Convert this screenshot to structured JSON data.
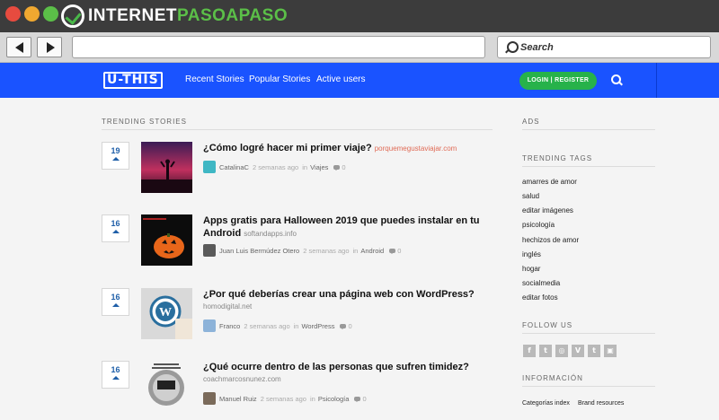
{
  "window": {
    "brand_prefix": "INTERNET",
    "brand_accent": "PASOAPASO",
    "search_placeholder": "Search"
  },
  "site": {
    "logo": "U-THIS",
    "nav": [
      "Recent Stories",
      "Popular Stories",
      "Active users"
    ],
    "login_label": "LOGIN | REGISTER",
    "brand_color": "#1a53ff",
    "login_color": "#27b24a"
  },
  "main": {
    "section_title": "TRENDING STORIES",
    "stories": [
      {
        "votes": "19",
        "title": "¿Cómo logré hacer mi primer viaje?",
        "domain": "porquemegustaviajar.com",
        "author": "CatalinaC",
        "time": "2 semanas ago",
        "in": "in",
        "category": "Viajes",
        "comments": "0"
      },
      {
        "votes": "16",
        "title": "Apps gratis para Halloween 2019 que puedes instalar en tu Android",
        "domain": "softandapps.info",
        "author": "Juan Luis Bermúdez Otero",
        "time": "2 semanas ago",
        "in": "in",
        "category": "Android",
        "comments": "0"
      },
      {
        "votes": "16",
        "title": "¿Por qué deberías crear una página web con WordPress?",
        "domain": "homodigital.net",
        "author": "Franco",
        "time": "2 semanas ago",
        "in": "in",
        "category": "WordPress",
        "comments": "0"
      },
      {
        "votes": "16",
        "title": "¿Qué ocurre dentro de las personas que sufren timidez?",
        "domain": "coachmarcosnunez.com",
        "author": "Manuel Ruiz",
        "time": "2 semanas ago",
        "in": "in",
        "category": "Psicología",
        "comments": "0"
      }
    ]
  },
  "sidebar": {
    "ads_title": "ADS",
    "tags_title": "TRENDING TAGS",
    "tags": [
      "amarres de amor",
      "salud",
      "editar imágenes",
      "psicología",
      "hechizos de amor",
      "inglés",
      "hogar",
      "socialmedia",
      "editar fotos"
    ],
    "follow_title": "FOLLOW US",
    "social": [
      {
        "icon": "facebook-icon",
        "glyph": "f"
      },
      {
        "icon": "twitter-icon",
        "glyph": "t"
      },
      {
        "icon": "instagram-icon",
        "glyph": "◎"
      },
      {
        "icon": "vk-icon",
        "glyph": "V"
      },
      {
        "icon": "tumblr-icon",
        "glyph": "t"
      },
      {
        "icon": "twitch-icon",
        "glyph": "▣"
      }
    ],
    "info_title": "INFORMACIÓN",
    "info_links": [
      "Categorías index",
      "Brand resources"
    ]
  }
}
